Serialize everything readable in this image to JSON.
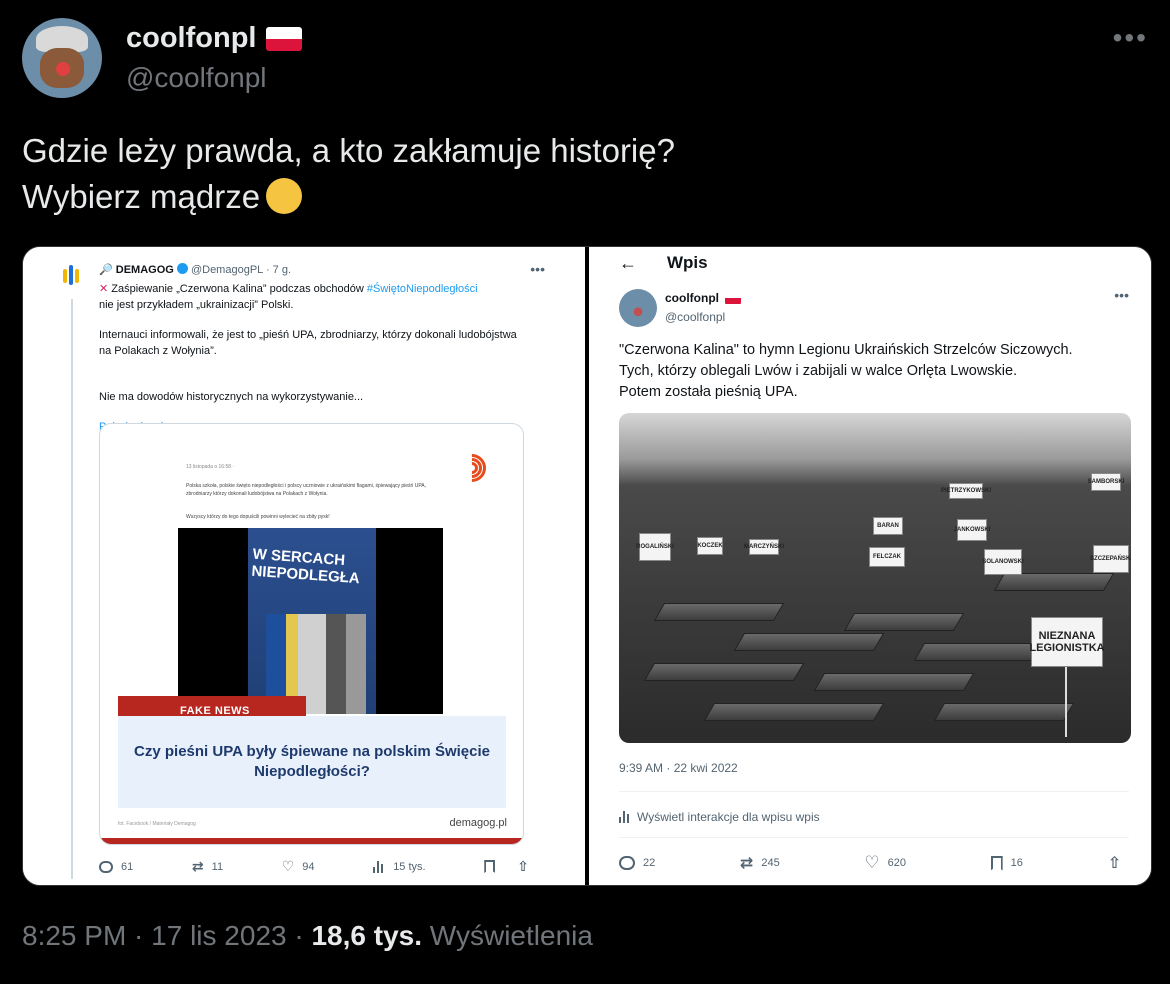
{
  "author": {
    "display_name": "coolfonpl",
    "handle": "@coolfonpl",
    "flag_icon": "poland-flag-icon"
  },
  "more_label": "•••",
  "tweet": {
    "line1": "Gdzie leży prawda, a kto zakłamuje historię?",
    "line2": "Wybierz mądrze",
    "emoji_icon": "pointing-hand-emoji"
  },
  "left_screenshot": {
    "account_name": "DEMAGOG",
    "account_handle": "@DemagogPL",
    "age": "· 7 g.",
    "lead_before": "Zaśpiewanie „Czerwona Kalina” podczas obchodów ",
    "hashtag": "#ŚwiętoNiepodległości",
    "lead_after": "nie jest przykładem „ukrainizacji” Polski.",
    "para2": "Internauci informowali, że jest to „pieśń UPA, zbrodniarzy, którzy dokonali ludobójstwa na Polakach z Wołynia”.",
    "para3": "Nie ma dowodów historycznych na wykorzystywanie...",
    "show_more": "Pokaż więcej",
    "card": {
      "post_date": "13 listopada o 16:58 · ",
      "post_text": "Polska szkoła, polskie święto niepodległości i polscy uczniowie z ukraińskimi flagami, śpiewający pieśń UPA, zbrodniarzy którzy dokonali ludobójstwa na Polakach z Wołynia.",
      "post_text2": "Wszyscy którzy do tego dopuścili powinni wylecieć na zbity pysk!",
      "banner": "W SERCACH NIEPODLEGŁA",
      "fake_label": "FAKE NEWS",
      "question": "Czy pieśni UPA były śpiewane na polskim Święcie Niepodległości?",
      "source": "demagog.pl",
      "credit": "fot. Facebook / Materiały Demagog"
    },
    "stats": {
      "replies": "61",
      "retweets": "11",
      "likes": "94",
      "views": "15 tys."
    }
  },
  "right_screenshot": {
    "header": "Wpis",
    "display_name": "coolfonpl",
    "handle": "@coolfonpl",
    "text1": "\"Czerwona Kalina\" to hymn Legionu Ukraińskich Strzelców Siczowych.",
    "text2": "Tych, którzy oblegali Lwów i zabijali w walce Orlęta Lwowskie.",
    "text3": "Potem została pieśnią UPA.",
    "photo_sign_big": "NIEZNANA LEGIONISTKA",
    "photo_signs": [
      "ROGALIŃSKI",
      "KOCZEK",
      "MARCZYŃSKI",
      "FELCZAK",
      "SOLANOWSKI",
      "SZCZEPAŃSKI",
      "PIETRZYKOWSKI",
      "BARAN",
      "JANKOWSKI",
      "SAMBORSKI"
    ],
    "timestamp": "9:39 AM · 22 kwi 2022",
    "interactions": "Wyświetl interakcje dla wpisu wpis",
    "stats": {
      "replies": "22",
      "retweets": "245",
      "likes": "620",
      "bookmarks": "16"
    }
  },
  "footer": {
    "time": "8:25 PM · 17 lis 2023 · ",
    "views": "18,6 tys.",
    "views_label": " Wyświetlenia"
  }
}
